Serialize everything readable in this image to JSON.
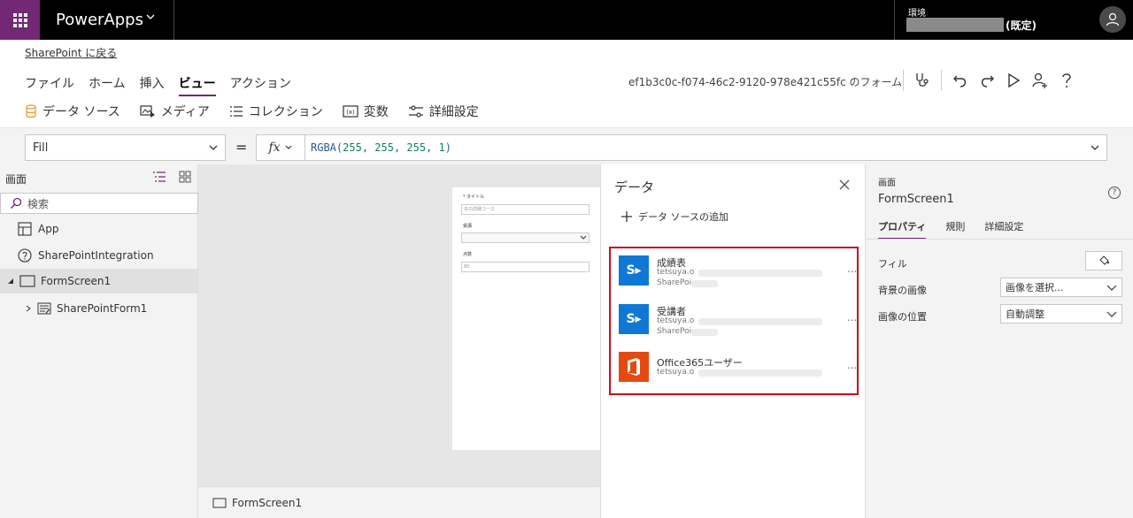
{
  "app": {
    "name": "PowerApps"
  },
  "environment": {
    "label": "環境",
    "default_suffix": "(既定)"
  },
  "back_link": "SharePoint に戻る",
  "menu": [
    {
      "label": "ファイル"
    },
    {
      "label": "ホーム"
    },
    {
      "label": "挿入"
    },
    {
      "label": "ビュー"
    },
    {
      "label": "アクション"
    }
  ],
  "form_id": "ef1b3c0c-f074-46c2-9120-978e421c55fc のフォーム",
  "ribbon": {
    "data_source": "データ ソース",
    "media": "メディア",
    "collection": "コレクション",
    "variables": "変数",
    "advanced": "詳細設定"
  },
  "formula": {
    "property": "Fill",
    "fx": "fx",
    "fn": "RGBA(",
    "a1": "255",
    "a2": "255",
    "a3": "255",
    "a4": "1",
    "sep": ", ",
    "close": ")"
  },
  "left_panel": {
    "title": "画面",
    "search_placeholder": "検索",
    "tree": [
      {
        "label": "App"
      },
      {
        "label": "SharePointIntegration"
      },
      {
        "label": "FormScreen1"
      },
      {
        "label": "SharePointForm1"
      }
    ]
  },
  "form_preview": {
    "field1_label": "タイトル",
    "field1_value": "本の詳細コース",
    "field2_label": "受講",
    "field2_value": "",
    "field3_label": "点数",
    "field3_value": "80"
  },
  "canvas_footer": "FormScreen1",
  "data_panel": {
    "title": "データ",
    "add_label": "データ ソースの追加",
    "sources": [
      {
        "name": "成績表",
        "account": "tetsuya.o",
        "type": "SharePoi",
        "color": "#0f78d4"
      },
      {
        "name": "受講者",
        "account": "tetsuya.o",
        "type": "SharePoi",
        "color": "#0f78d4"
      },
      {
        "name": "Office365ユーザー",
        "account": "tetsuya.o",
        "type": "",
        "color": "#e44a0f"
      }
    ],
    "more": "..."
  },
  "right_panel": {
    "label": "画面",
    "title": "FormScreen1",
    "tabs": [
      {
        "label": "プロパティ"
      },
      {
        "label": "規則"
      },
      {
        "label": "詳細設定"
      }
    ],
    "fill_label": "フィル",
    "bg_image_label": "背景の画像",
    "bg_image_value": "画像を選択...",
    "image_position_label": "画像の位置",
    "image_position_value": "自動調整"
  },
  "colors": {
    "accent": "#742774",
    "highlight": "#c50f1f",
    "sharepoint": "#0f78d4",
    "office": "#e44a0f"
  }
}
